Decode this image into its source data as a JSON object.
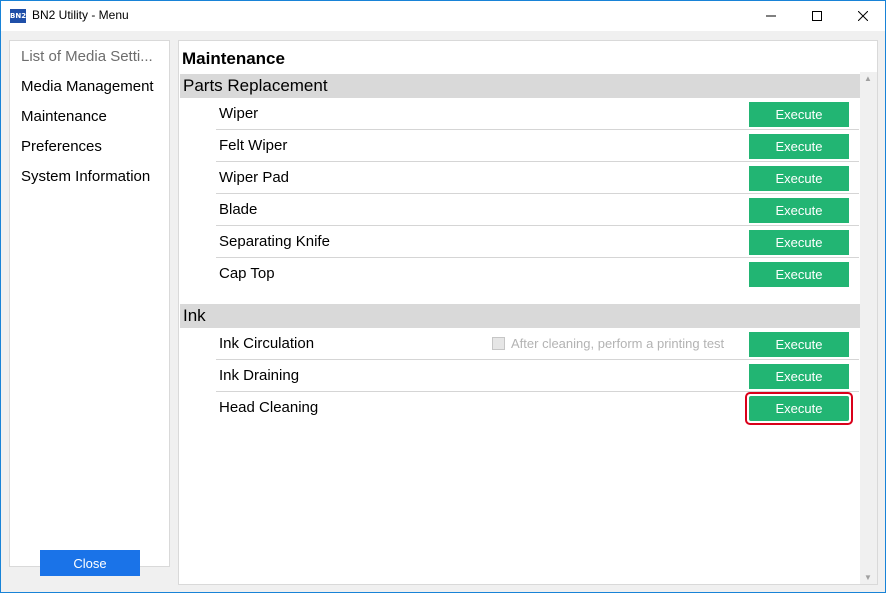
{
  "window": {
    "title": "BN2 Utility - Menu",
    "icon_text": "BN2"
  },
  "sidebar": {
    "items": [
      {
        "label": "List of Media Setti..."
      },
      {
        "label": "Media Management"
      },
      {
        "label": "Maintenance"
      },
      {
        "label": "Preferences"
      },
      {
        "label": "System Information"
      }
    ],
    "close_label": "Close"
  },
  "main": {
    "title": "Maintenance",
    "sections": [
      {
        "header": "Parts Replacement",
        "rows": [
          {
            "label": "Wiper",
            "button": "Execute"
          },
          {
            "label": "Felt Wiper",
            "button": "Execute"
          },
          {
            "label": "Wiper Pad",
            "button": "Execute"
          },
          {
            "label": "Blade",
            "button": "Execute"
          },
          {
            "label": "Separating Knife",
            "button": "Execute"
          },
          {
            "label": "Cap Top",
            "button": "Execute"
          }
        ]
      },
      {
        "header": "Ink",
        "rows": [
          {
            "label": "Ink Circulation",
            "button": "Execute",
            "checkbox_label": "After cleaning, perform a printing test",
            "checkbox_checked": false,
            "checkbox_enabled": false
          },
          {
            "label": "Ink Draining",
            "button": "Execute"
          },
          {
            "label": "Head Cleaning",
            "button": "Execute",
            "highlighted": true
          }
        ]
      }
    ]
  },
  "colors": {
    "execute": "#22b573",
    "close": "#1a73e8",
    "highlight": "#d9001a",
    "section_bg": "#d9d9d9"
  }
}
